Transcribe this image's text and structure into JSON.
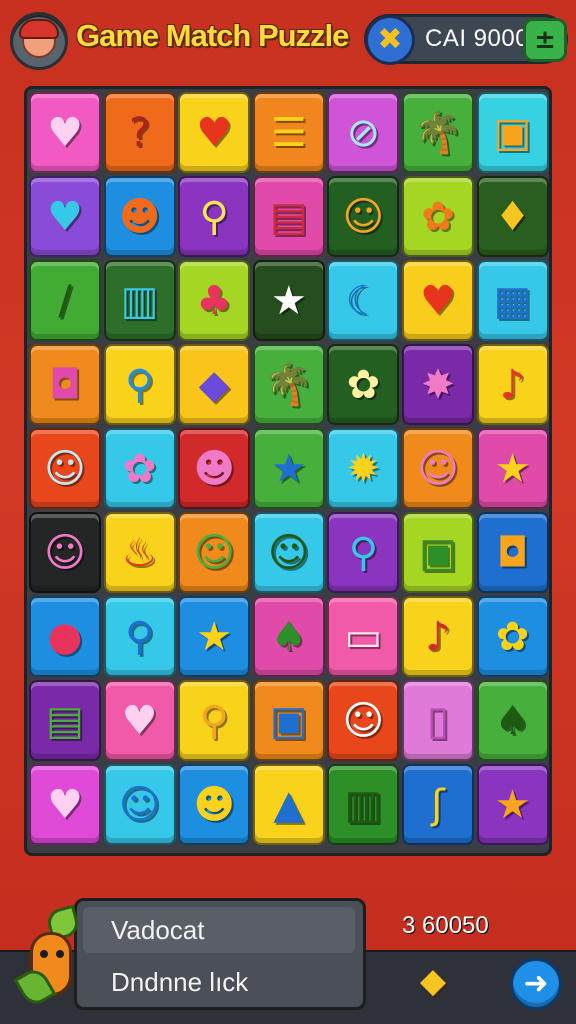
{
  "header": {
    "title": "Game Match Puzzle",
    "currency_value": "CAI 9000",
    "avatar_icon": "player-avatar-icon",
    "coin_icon": "coin-cross-icon",
    "plus_icon": "plus-icon"
  },
  "board": {
    "columns": 7,
    "rows": [
      [
        {
          "icon": "heart-icon",
          "glyph": "♥",
          "bg": "#f15ac3",
          "fg": "#ffd1f0"
        },
        {
          "icon": "question-icon",
          "glyph": "?",
          "bg": "#f06a1c",
          "fg": "#b0201c"
        },
        {
          "icon": "heart-icon",
          "glyph": "♥",
          "bg": "#f9d21b",
          "fg": "#e8341c"
        },
        {
          "icon": "lantern-icon",
          "glyph": "☰",
          "bg": "#f2861e",
          "fg": "#f9d21b"
        },
        {
          "icon": "compass-icon",
          "glyph": "⊘",
          "bg": "#d054d8",
          "fg": "#a7e7ff"
        },
        {
          "icon": "palm-tree-icon",
          "glyph": "🌴",
          "bg": "#47b03c",
          "fg": "#205f18"
        },
        {
          "icon": "radio-icon",
          "glyph": "▣",
          "bg": "#36d2e2",
          "fg": "#f7a51c"
        }
      ],
      [
        {
          "icon": "heart-icon",
          "glyph": "♥",
          "bg": "#8a4bd8",
          "fg": "#37c8e8"
        },
        {
          "icon": "smiley-icon",
          "glyph": "☻",
          "bg": "#1e8fe0",
          "fg": "#f06a1c"
        },
        {
          "icon": "magnifier-icon",
          "glyph": "⚲",
          "bg": "#8a34c0",
          "fg": "#f6e35a"
        },
        {
          "icon": "scroll-icon",
          "glyph": "▤",
          "bg": "#e04aa8",
          "fg": "#d12a3a"
        },
        {
          "icon": "cat-face-icon",
          "glyph": "☺",
          "bg": "#245f22",
          "fg": "#f6a51c"
        },
        {
          "icon": "flower-icon",
          "glyph": "✿",
          "bg": "#a6d624",
          "fg": "#f07a1c"
        },
        {
          "icon": "drop-icon",
          "glyph": "♦",
          "bg": "#2a5e1e",
          "fg": "#f6c521"
        }
      ],
      [
        {
          "icon": "crayon-icon",
          "glyph": "/",
          "bg": "#42ab34",
          "fg": "#1f5a12"
        },
        {
          "icon": "barrel-icon",
          "glyph": "▥",
          "bg": "#2d6f2a",
          "fg": "#37c8e8"
        },
        {
          "icon": "shell-icon",
          "glyph": "♣",
          "bg": "#a6d624",
          "fg": "#e8345c"
        },
        {
          "icon": "star-icon",
          "glyph": "★",
          "bg": "#254d1e",
          "fg": "#ffffff"
        },
        {
          "icon": "moon-icon",
          "glyph": "☾",
          "bg": "#36c8e8",
          "fg": "#1e6fd0"
        },
        {
          "icon": "heart-icon",
          "glyph": "♥",
          "bg": "#f9cd1b",
          "fg": "#e8341c"
        },
        {
          "icon": "keyboard-icon",
          "glyph": "▦",
          "bg": "#36c8e8",
          "fg": "#1e6fd0"
        }
      ],
      [
        {
          "icon": "bag-icon",
          "glyph": "◘",
          "bg": "#f08a1c",
          "fg": "#e04aa8"
        },
        {
          "icon": "spoon-icon",
          "glyph": "⚲",
          "bg": "#f9d21b",
          "fg": "#1e8fe0"
        },
        {
          "icon": "cube-icon",
          "glyph": "◆",
          "bg": "#f9c51b",
          "fg": "#6a4ad8"
        },
        {
          "icon": "palm-tree-icon",
          "glyph": "🌴",
          "bg": "#47b03c",
          "fg": "#1f5a12"
        },
        {
          "icon": "flower-icon",
          "glyph": "✿",
          "bg": "#245f22",
          "fg": "#fff3a0"
        },
        {
          "icon": "badge-icon",
          "glyph": "✸",
          "bg": "#7a2aa8",
          "fg": "#f07ac8"
        },
        {
          "icon": "lollipop-icon",
          "glyph": "♪",
          "bg": "#f9d21b",
          "fg": "#e8341c"
        }
      ],
      [
        {
          "icon": "cat-face-icon",
          "glyph": "☺",
          "bg": "#e8471c",
          "fg": "#bfeaf5"
        },
        {
          "icon": "flower-icon",
          "glyph": "✿",
          "bg": "#36c8e8",
          "fg": "#f07ac8"
        },
        {
          "icon": "monster-face-icon",
          "glyph": "☻",
          "bg": "#d22a2a",
          "fg": "#f07ac8"
        },
        {
          "icon": "starfish-icon",
          "glyph": "★",
          "bg": "#47b03c",
          "fg": "#1e6fd0"
        },
        {
          "icon": "sun-icon",
          "glyph": "✹",
          "bg": "#36c8e8",
          "fg": "#f9d21b"
        },
        {
          "icon": "pig-face-icon",
          "glyph": "☺",
          "bg": "#f08a1c",
          "fg": "#f07ac8"
        },
        {
          "icon": "star-icon",
          "glyph": "★",
          "bg": "#e04aa8",
          "fg": "#f9d21b"
        }
      ],
      [
        {
          "icon": "pig-face-icon",
          "glyph": "☺",
          "bg": "#242626",
          "fg": "#f07ac8"
        },
        {
          "icon": "squid-icon",
          "glyph": "♨",
          "bg": "#f9d21b",
          "fg": "#e8341c"
        },
        {
          "icon": "frog-face-icon",
          "glyph": "☺",
          "bg": "#f08a1c",
          "fg": "#47b03c"
        },
        {
          "icon": "bug-face-icon",
          "glyph": "☺",
          "bg": "#36c8e8",
          "fg": "#1f5a12"
        },
        {
          "icon": "pin-icon",
          "glyph": "⚲",
          "bg": "#8a34c0",
          "fg": "#36c8e8"
        },
        {
          "icon": "box-icon",
          "glyph": "▣",
          "bg": "#a6d624",
          "fg": "#2d8f28"
        },
        {
          "icon": "suitcase-icon",
          "glyph": "◘",
          "bg": "#1e6fd0",
          "fg": "#f6a51c"
        }
      ],
      [
        {
          "icon": "berry-icon",
          "glyph": "●",
          "bg": "#1e8fe0",
          "fg": "#e8345c"
        },
        {
          "icon": "lollipop-icon",
          "glyph": "⚲",
          "bg": "#36c8e8",
          "fg": "#1e6fd0"
        },
        {
          "icon": "star-icon",
          "glyph": "★",
          "bg": "#1e8fe0",
          "fg": "#f9d21b"
        },
        {
          "icon": "leaf-icon",
          "glyph": "♠",
          "bg": "#e04aa8",
          "fg": "#2d8f28"
        },
        {
          "icon": "bandage-icon",
          "glyph": "▭",
          "bg": "#f15aa8",
          "fg": "#ffe0ef"
        },
        {
          "icon": "match-icon",
          "glyph": "♪",
          "bg": "#f9d21b",
          "fg": "#d22a2a"
        },
        {
          "icon": "flower-icon",
          "glyph": "✿",
          "bg": "#1e8fe0",
          "fg": "#f9d21b"
        }
      ],
      [
        {
          "icon": "phone-icon",
          "glyph": "▤",
          "bg": "#7a2aa8",
          "fg": "#47b03c"
        },
        {
          "icon": "heart-icon",
          "glyph": "♥",
          "bg": "#f15aa8",
          "fg": "#ffd1f0"
        },
        {
          "icon": "magnifier-icon",
          "glyph": "⚲",
          "bg": "#f9d21b",
          "fg": "#f6a51c"
        },
        {
          "icon": "tray-icon",
          "glyph": "▣",
          "bg": "#f08a1c",
          "fg": "#1e6fd0"
        },
        {
          "icon": "cat-face-icon",
          "glyph": "☺",
          "bg": "#e8471c",
          "fg": "#ffffff"
        },
        {
          "icon": "cup-icon",
          "glyph": "▯",
          "bg": "#e07ad8",
          "fg": "#c04ac0"
        },
        {
          "icon": "leaf-icon",
          "glyph": "♠",
          "bg": "#47b03c",
          "fg": "#1f5a12"
        }
      ],
      [
        {
          "icon": "heart-icon",
          "glyph": "♥",
          "bg": "#e04ad8",
          "fg": "#ffd1f0"
        },
        {
          "icon": "smiley-icon",
          "glyph": "☺",
          "bg": "#36c8e8",
          "fg": "#1e6fd0"
        },
        {
          "icon": "monster-face-icon",
          "glyph": "☻",
          "bg": "#1e8fe0",
          "fg": "#f9d21b"
        },
        {
          "icon": "bottle-icon",
          "glyph": "▲",
          "bg": "#f9d21b",
          "fg": "#1e6fd0"
        },
        {
          "icon": "basket-icon",
          "glyph": "▥",
          "bg": "#2d8f28",
          "fg": "#1f5a12"
        },
        {
          "icon": "hook-icon",
          "glyph": "ʃ",
          "bg": "#1e6fd0",
          "fg": "#f9d21b"
        },
        {
          "icon": "star-icon",
          "glyph": "★",
          "bg": "#8a34c0",
          "fg": "#f6a51c"
        }
      ]
    ]
  },
  "footer": {
    "line1": "Vadocat",
    "line2": "Dndnne lıck",
    "total": "3 60050",
    "mascot_icon": "carrot-mascot-icon",
    "gem_icon": "gem-icon",
    "next_icon": "arrow-right-icon"
  }
}
